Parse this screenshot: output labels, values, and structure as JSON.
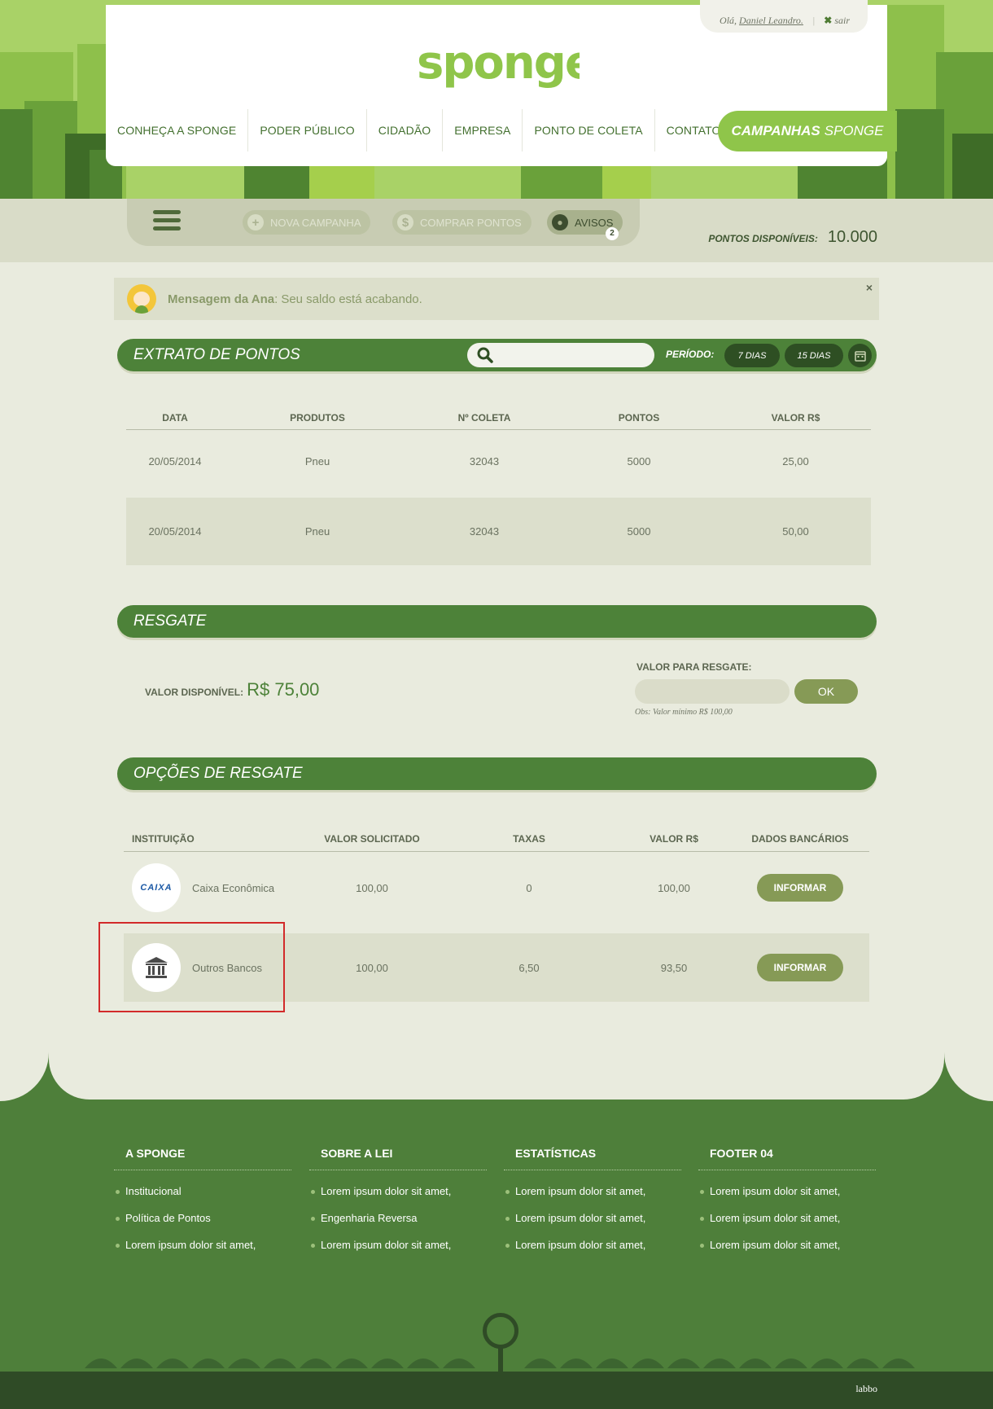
{
  "header": {
    "greeting_prefix": "Olá,",
    "user_name": "Daniel Leandro.",
    "separator": "|",
    "logout_label": "sair",
    "logo_text": "sponge",
    "nav": [
      {
        "label": "CONHEÇA A SPONGE"
      },
      {
        "label": "PODER PÚBLICO"
      },
      {
        "label": "CIDADÃO"
      },
      {
        "label": "EMPRESA"
      },
      {
        "label": "PONTO DE COLETA"
      },
      {
        "label": "CONTATO"
      }
    ],
    "campaign_bold": "CAMPANHAS",
    "campaign_light": "SPONGE"
  },
  "toolbar": {
    "new_campaign": "NOVA CAMPANHA",
    "buy_points": "COMPRAR PONTOS",
    "notices": "AVISOS",
    "notices_count": "2",
    "points_label": "PONTOS DISPONÍVEIS:",
    "points_value": "10.000"
  },
  "message": {
    "from": "Mensagem da Ana",
    "text": "Seu saldo está acabando.",
    "close": "×"
  },
  "extrato": {
    "title": "EXTRATO DE PONTOS",
    "search_placeholder": "",
    "period_label": "PERÍODO:",
    "period_7": "7 DIAS",
    "period_15": "15 DIAS",
    "columns": [
      "DATA",
      "PRODUTOS",
      "Nº COLETA",
      "PONTOS",
      "VALOR R$"
    ],
    "rows": [
      {
        "data": "20/05/2014",
        "produto": "Pneu",
        "coleta": "32043",
        "pontos": "5000",
        "valor": "25,00"
      },
      {
        "data": "20/05/2014",
        "produto": "Pneu",
        "coleta": "32043",
        "pontos": "5000",
        "valor": "50,00"
      }
    ]
  },
  "resgate": {
    "title": "RESGATE",
    "available_label": "VALOR DISPONÍVEL:",
    "available_value": "R$ 75,00",
    "request_label": "VALOR PARA RESGATE:",
    "request_value": "",
    "ok_label": "OK",
    "obs": "Obs: Valor mínimo R$ 100,00"
  },
  "opcoes": {
    "title": "OPÇÕES DE RESGATE",
    "columns": [
      "INSTITUIÇÃO",
      "VALOR SOLICITADO",
      "TAXAS",
      "VALOR R$",
      "DADOS BANCÁRIOS"
    ],
    "rows": [
      {
        "logo_text": "CAIXA",
        "icon": "caixa-logo",
        "name": "Caixa Econômica",
        "solicitado": "100,00",
        "taxas": "0",
        "valor": "100,00",
        "action": "INFORMAR"
      },
      {
        "logo_text": "",
        "icon": "bank-icon",
        "name": "Outros Bancos",
        "solicitado": "100,00",
        "taxas": "6,50",
        "valor": "93,50",
        "action": "INFORMAR"
      }
    ]
  },
  "footer": {
    "columns": [
      {
        "title": "A SPONGE",
        "links": [
          "Institucional",
          "Política de Pontos",
          "Lorem ipsum dolor sit amet,"
        ]
      },
      {
        "title": "SOBRE A LEI",
        "links": [
          "Lorem ipsum dolor sit amet,",
          "Engenharia Reversa",
          "Lorem ipsum dolor sit amet,"
        ]
      },
      {
        "title": "ESTATÍSTICAS",
        "links": [
          "Lorem ipsum dolor sit amet,",
          "Lorem ipsum dolor sit amet,",
          "Lorem ipsum dolor sit amet,"
        ]
      },
      {
        "title": "FOOTER 04",
        "links": [
          "Lorem ipsum dolor sit amet,",
          "Lorem ipsum dolor sit amet,",
          "Lorem ipsum dolor sit amet,"
        ]
      }
    ],
    "credit": "labbo"
  },
  "colors": {
    "brand_green": "#8fc54a",
    "dark_green": "#4d8239",
    "olive_button": "#869a56",
    "highlight_red": "#d22a2a"
  }
}
